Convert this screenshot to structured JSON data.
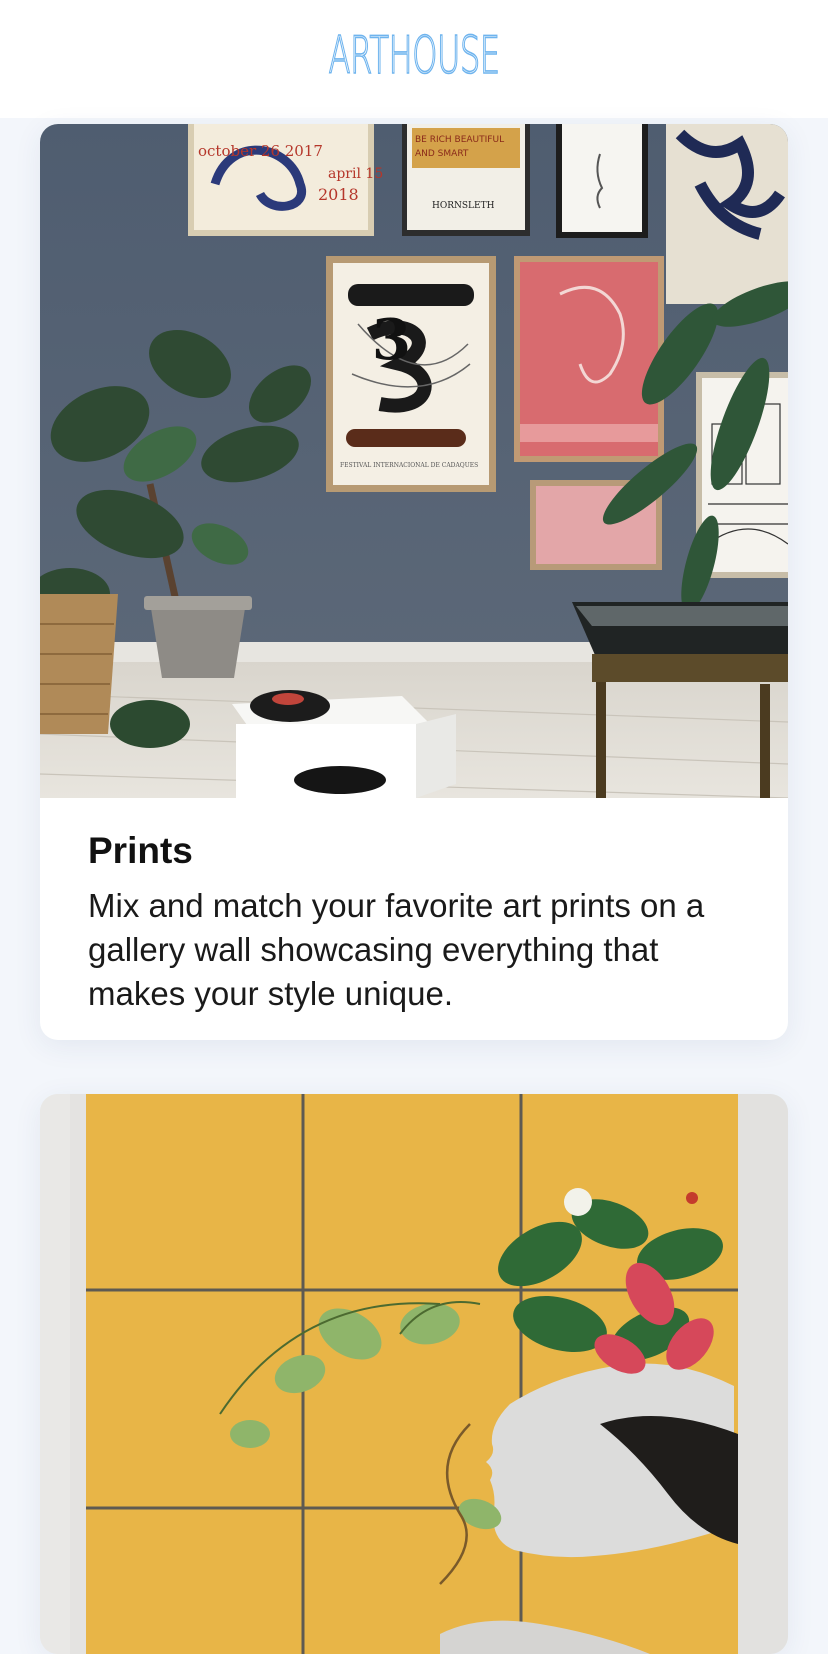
{
  "app": {
    "brand": "ARTHOUSE"
  },
  "colors": {
    "brand": "#6fb4ee",
    "page_background": "#f3f6fb",
    "card_background": "#ffffff"
  },
  "cards": [
    {
      "title": "Prints",
      "description": "Mix and match your favorite art prints on a gallery wall showcasing everything that makes your style unique.",
      "image": {
        "type": "photo",
        "wall_prints": [
          {
            "lines": [
              "october 26 2017",
              "april 15",
              "2018"
            ]
          },
          {
            "lines": [
              "BE RICH BEAUTIFUL",
              "AND SMART",
              "HORNSLETH"
            ]
          },
          {
            "lines": [
              "3",
              "FESTIVAL INTERNACIONAL DE CADAQUES"
            ]
          }
        ]
      }
    },
    {
      "title": "",
      "description": "",
      "image": {
        "type": "photo",
        "subject": "botanical portrait artwork on yellow wood panels"
      }
    }
  ]
}
